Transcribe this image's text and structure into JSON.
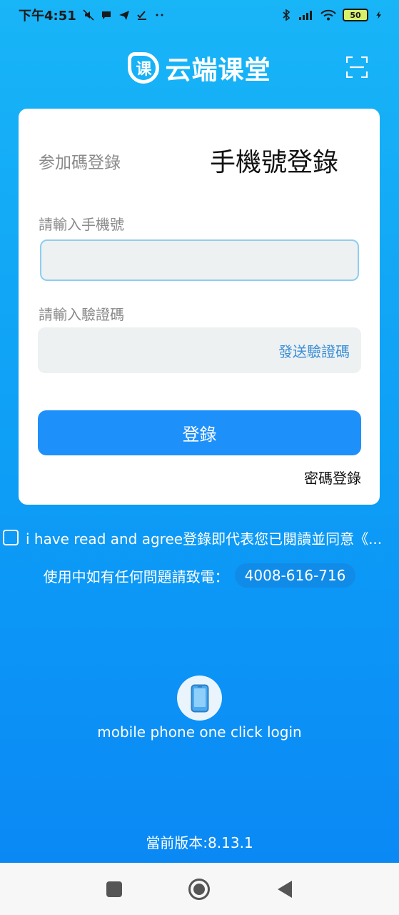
{
  "status_bar": {
    "time": "下午4:51",
    "battery": "50"
  },
  "header": {
    "logo_mark": "课",
    "logo_text": "云端课堂"
  },
  "login_card": {
    "tab_code": "参加碼登錄",
    "tab_phone": "手機號登錄",
    "phone_label": "請輸入手機號",
    "phone_value": "",
    "code_label": "請輸入驗證碼",
    "code_value": "",
    "send_code": "發送驗證碼",
    "login_button": "登錄",
    "password_login": "密碼登錄"
  },
  "agreement": {
    "text": "i have read and agree登錄即代表您已閱讀並同意《..."
  },
  "support": {
    "label": "使用中如有任何問題請致電：",
    "phone": "4008-616-716"
  },
  "one_click": {
    "label": "mobile phone one click login"
  },
  "version": {
    "text": "當前版本:8.13.1"
  },
  "colors": {
    "bg_top": "#18b5f7",
    "bg_bottom": "#0a86f5",
    "primary_button": "#1e90fa",
    "link_blue": "#3b8fd6"
  },
  "icons": {
    "status": [
      "mute-icon",
      "chat-icon",
      "telegram-icon",
      "check-icon",
      "more-icon",
      "bluetooth-icon",
      "signal-icon",
      "wifi-icon",
      "battery-icon",
      "charging-icon"
    ],
    "header": "scan-icon",
    "one_click": "phone-icon",
    "nav": [
      "recent-apps-icon",
      "home-icon",
      "back-icon"
    ]
  }
}
